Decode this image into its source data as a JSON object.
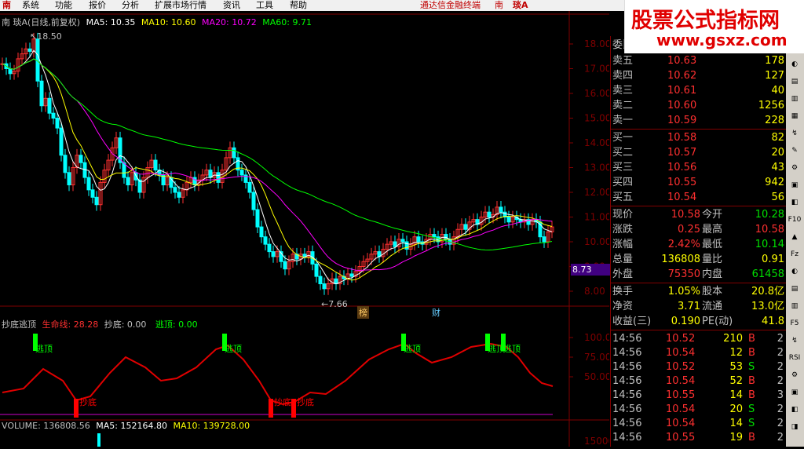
{
  "menubar": {
    "items": [
      "南",
      "系统",
      "功能",
      "报价",
      "分析",
      "扩展市场行情",
      "资讯",
      "工具",
      "帮助"
    ],
    "right_items": [
      "通达信金融终端",
      "南",
      "琰A"
    ],
    "close_glyph": "×"
  },
  "watermark": {
    "title": "股票公式指标网",
    "url": "www.gsxz.com"
  },
  "main_legend": {
    "prefix": "南  琰A(日线,前复权)",
    "ma5": "MA5: 10.35",
    "ma10": "MA10: 10.60",
    "ma20": "MA20: 10.72",
    "ma60": "MA60: 9.71"
  },
  "price_axis": [
    "18.00",
    "17.00",
    "16.00",
    "15.00",
    "14.00",
    "13.00",
    "12.00",
    "11.00",
    "10.00",
    "9.00",
    "8.00"
  ],
  "axis_marker": "8.73",
  "annotations": {
    "high": "18.50",
    "low": "7.66",
    "tag1": "榜",
    "tag2": "财"
  },
  "indicator_legend": {
    "name": "抄底逃顶",
    "life": "生命线: 28.28",
    "buy": "抄底: 0.00",
    "sell": "逃顶: 0.00"
  },
  "indicator_axis": [
    "100.00",
    "75.00",
    "50.00"
  ],
  "indicator_labels": {
    "top": "逃顶",
    "bottom": "抄底"
  },
  "volume_legend": {
    "vol": "VOLUME: 136808.56",
    "ma5": "MA5: 152164.80",
    "ma10": "MA10: 139728.00"
  },
  "volume_axis": "15000",
  "quote": {
    "header_left": "委比",
    "header_right": "委差",
    "asks": [
      {
        "label": "卖五",
        "price": "10.63",
        "vol": "178"
      },
      {
        "label": "卖四",
        "price": "10.62",
        "vol": "127"
      },
      {
        "label": "卖三",
        "price": "10.61",
        "vol": "40"
      },
      {
        "label": "卖二",
        "price": "10.60",
        "vol": "1256"
      },
      {
        "label": "卖一",
        "price": "10.59",
        "vol": "228"
      }
    ],
    "bids": [
      {
        "label": "买一",
        "price": "10.58",
        "vol": "82"
      },
      {
        "label": "买二",
        "price": "10.57",
        "vol": "20"
      },
      {
        "label": "买三",
        "price": "10.56",
        "vol": "43"
      },
      {
        "label": "买四",
        "price": "10.55",
        "vol": "942"
      },
      {
        "label": "买五",
        "price": "10.54",
        "vol": "56"
      }
    ],
    "stats": [
      {
        "l1": "现价",
        "v1": "10.58",
        "c1": "#ff3030",
        "l2": "今开",
        "v2": "10.28",
        "c2": "#00e000"
      },
      {
        "l1": "涨跌",
        "v1": "0.25",
        "c1": "#ff3030",
        "l2": "最高",
        "v2": "10.58",
        "c2": "#ff3030"
      },
      {
        "l1": "涨幅",
        "v1": "2.42%",
        "c1": "#ff3030",
        "l2": "最低",
        "v2": "10.14",
        "c2": "#00e000"
      },
      {
        "l1": "总量",
        "v1": "136808",
        "c1": "#ffff00",
        "l2": "量比",
        "v2": "0.91",
        "c2": "#ffff00"
      },
      {
        "l1": "外盘",
        "v1": "75350",
        "c1": "#ff3030",
        "l2": "内盘",
        "v2": "61458",
        "c2": "#00e000"
      }
    ],
    "fund": [
      {
        "l1": "换手",
        "v1": "1.05%",
        "l2": "股本",
        "v2": "20.8亿"
      },
      {
        "l1": "净资",
        "v1": "3.71",
        "l2": "流通",
        "v2": "13.0亿"
      },
      {
        "l1": "收益(三)",
        "v1": "0.190",
        "l2": "PE(动)",
        "v2": "41.8"
      }
    ],
    "ticks": [
      {
        "time": "14:56",
        "price": "10.52",
        "vol": "210",
        "bs": "B",
        "n": "2"
      },
      {
        "time": "14:56",
        "price": "10.54",
        "vol": "12",
        "bs": "B",
        "n": "2"
      },
      {
        "time": "14:56",
        "price": "10.52",
        "vol": "53",
        "bs": "S",
        "n": "2"
      },
      {
        "time": "14:56",
        "price": "10.54",
        "vol": "52",
        "bs": "B",
        "n": "2"
      },
      {
        "time": "14:56",
        "price": "10.55",
        "vol": "14",
        "bs": "B",
        "n": "3"
      },
      {
        "time": "14:56",
        "price": "10.54",
        "vol": "20",
        "bs": "S",
        "n": "2"
      },
      {
        "time": "14:56",
        "price": "10.54",
        "vol": "14",
        "bs": "S",
        "n": "2"
      },
      {
        "time": "14:56",
        "price": "10.55",
        "vol": "19",
        "bs": "B",
        "n": "2"
      }
    ]
  },
  "toolbar": [
    "F10",
    "Fz",
    "F5",
    "RSI"
  ],
  "colors": {
    "up": "#ff3030",
    "down": "#00ffff",
    "ma5": "#ffffff",
    "ma10": "#ffff00",
    "ma20": "#ff00ff",
    "ma60": "#00ff00",
    "life": "#e00000",
    "buy_bar": "#ff0000",
    "sell_bar": "#00ff00",
    "border": "#800000"
  }
}
